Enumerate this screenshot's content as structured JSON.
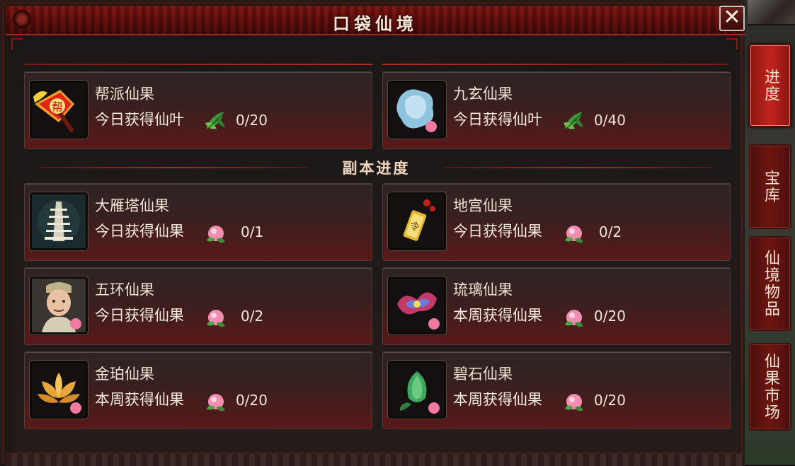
{
  "window": {
    "title": "口袋仙境",
    "close_label": "✕"
  },
  "top_cards": [
    {
      "name": "帮派仙果",
      "desc": "今日获得仙叶",
      "count": "0/20",
      "icon": "guild-flag-icon",
      "reward_icon": "leaf-icon",
      "badge_text": "帮"
    },
    {
      "name": "九玄仙果",
      "desc": "今日获得仙叶",
      "count": "0/40",
      "icon": "blue-jade-icon",
      "reward_icon": "leaf-icon"
    }
  ],
  "section": {
    "label": "副本进度"
  },
  "dungeon_cards": [
    {
      "name": "大雁塔仙果",
      "desc": "今日获得仙果",
      "count": "0/1",
      "icon": "pagoda-icon",
      "reward_icon": "peach-icon"
    },
    {
      "name": "地宫仙果",
      "desc": "今日获得仙果",
      "count": "0/2",
      "icon": "token-icon",
      "reward_icon": "peach-icon",
      "badge_text": "令"
    },
    {
      "name": "五环仙果",
      "desc": "今日获得仙果",
      "count": "0/2",
      "icon": "old-man-portrait-icon",
      "reward_icon": "peach-icon"
    },
    {
      "name": "琉璃仙果",
      "desc": "本周获得仙果",
      "count": "0/20",
      "icon": "glass-flower-icon",
      "reward_icon": "peach-icon"
    },
    {
      "name": "金珀仙果",
      "desc": "本周获得仙果",
      "count": "0/20",
      "icon": "amber-lotus-icon",
      "reward_icon": "peach-icon"
    },
    {
      "name": "碧石仙果",
      "desc": "本周获得仙果",
      "count": "0/20",
      "icon": "jade-fruit-icon",
      "reward_icon": "peach-icon"
    }
  ],
  "tabs": [
    {
      "label": "进度",
      "active": true
    },
    {
      "label": "宝库",
      "active": false
    },
    {
      "label": "仙境物品",
      "active": false
    },
    {
      "label": "仙果市场",
      "active": false
    }
  ],
  "colors": {
    "accent": "#c2241c",
    "text": "#efe2d2",
    "card_bg": "#3a1f1f"
  }
}
